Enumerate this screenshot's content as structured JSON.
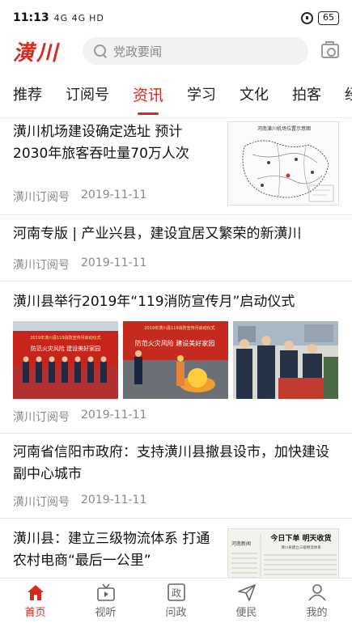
{
  "status_bar": {
    "time": "11:13",
    "signal": "4G 4G",
    "hd": "HD",
    "battery": "65"
  },
  "header": {
    "logo": "潢川",
    "search_placeholder": "党政要闻"
  },
  "tabs": [
    "推荐",
    "订阅号",
    "资讯",
    "学习",
    "文化",
    "拍客",
    "经济"
  ],
  "active_tab": "资讯",
  "articles": [
    {
      "title": "潢川机场建设确定选址 预计2030年旅客吞吐量70万人次",
      "source": "潢川订阅号",
      "date": "2019-11-11"
    },
    {
      "title": "河南专版 | 产业兴县，建设宜居又繁荣的新潢川",
      "source": "潢川订阅号",
      "date": "2019-11-11"
    },
    {
      "title": "潢川县举行2019年“119消防宣传月”启动仪式",
      "source": "潢川订阅号",
      "date": "2019-11-11"
    },
    {
      "title": "河南省信阳市政府：支持潢川县撤县设市，加快建设副中心城市",
      "source": "潢川订阅号",
      "date": "2019-11-11"
    },
    {
      "title": "潢川县：建立三级物流体系 打通农村电商“最后一公里”",
      "source": "",
      "date": ""
    }
  ],
  "thumb_text": {
    "map_title": "河南潢川机场位置示意图",
    "news_headline": "今日下单 明天收货",
    "news_sub": "潢川县建立三级物流体系",
    "news_section": "河南新闻",
    "fire_banner1": "2019年潢川县119消防宣传月启动仪式",
    "fire_banner2": "防范火灾风险 建设美好家园"
  },
  "colors": {
    "accent": "#d42a1f"
  },
  "bottom_nav": [
    {
      "label": "首页",
      "icon": "home-icon"
    },
    {
      "label": "视听",
      "icon": "tv-icon"
    },
    {
      "label": "问政",
      "icon": "zheng-icon"
    },
    {
      "label": "便民",
      "icon": "send-icon"
    },
    {
      "label": "我的",
      "icon": "user-icon"
    }
  ]
}
